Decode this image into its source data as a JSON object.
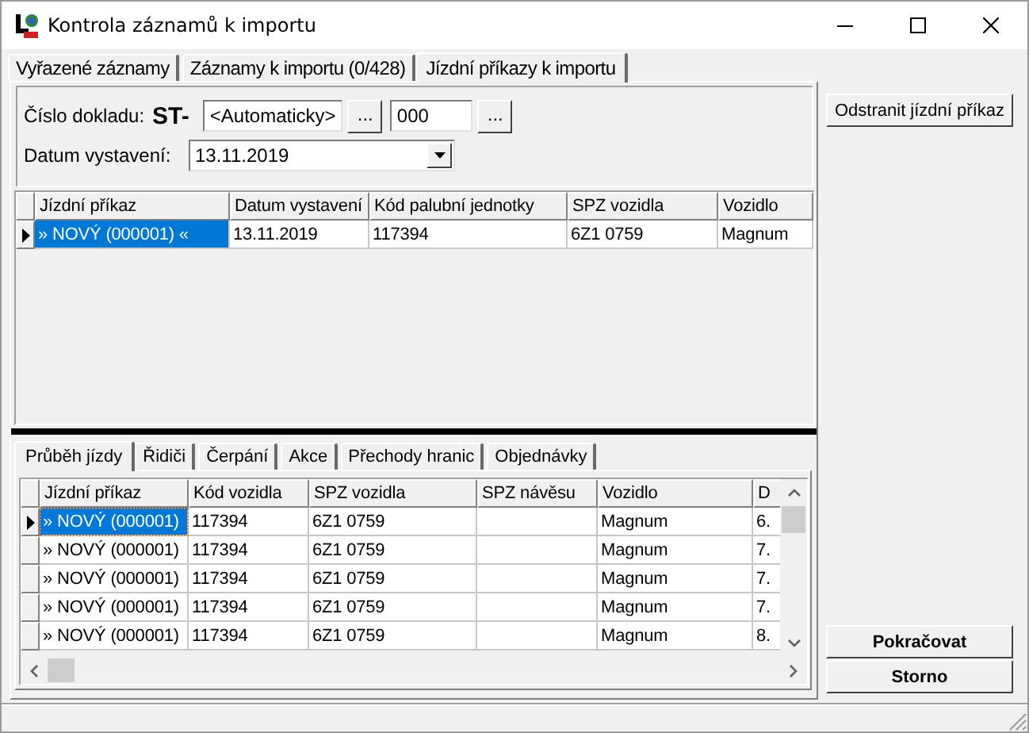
{
  "window": {
    "title": "Kontrola záznamů k importu"
  },
  "tabs": [
    {
      "label": "Vyřazené záznamy",
      "selected": false
    },
    {
      "label": "Záznamy k importu (0/428)",
      "selected": false
    },
    {
      "label": "Jízdní příkazy k importu",
      "selected": true
    }
  ],
  "document_form": {
    "number_label": "Číslo dokladu:",
    "prefix": "ST-",
    "number_value": "<Automaticky>",
    "number_button": "...",
    "sequence_value": "000",
    "sequence_button": "...",
    "date_label": "Datum vystavení:",
    "date_value": "13.11.2019"
  },
  "orders_table": {
    "columns": [
      "Jízdní příkaz",
      "Datum vystavení",
      "Kód palubní jednotky",
      "SPZ vozidla",
      "Vozidlo"
    ],
    "rows": [
      {
        "cells": [
          "» NOVÝ (000001) «",
          "13.11.2019",
          "117394",
          "6Z1 0759",
          "Magnum"
        ],
        "selected": true
      }
    ]
  },
  "detail_tabs": [
    {
      "label": "Průběh jízdy",
      "selected": true
    },
    {
      "label": "Řidiči",
      "selected": false
    },
    {
      "label": "Čerpání",
      "selected": false
    },
    {
      "label": "Akce",
      "selected": false
    },
    {
      "label": "Přechody hranic",
      "selected": false
    },
    {
      "label": "Objednávky",
      "selected": false
    }
  ],
  "detail_table": {
    "columns": [
      "Jízdní příkaz",
      "Kód vozidla",
      "SPZ vozidla",
      "SPZ návěsu",
      "Vozidlo",
      "D"
    ],
    "rows": [
      {
        "cells": [
          "» NOVÝ (000001)",
          "117394",
          "6Z1 0759",
          "",
          "Magnum",
          "6."
        ],
        "selected": true
      },
      {
        "cells": [
          "» NOVÝ (000001)",
          "117394",
          "6Z1 0759",
          "",
          "Magnum",
          "7."
        ],
        "selected": false
      },
      {
        "cells": [
          "» NOVÝ (000001)",
          "117394",
          "6Z1 0759",
          "",
          "Magnum",
          "7."
        ],
        "selected": false
      },
      {
        "cells": [
          "» NOVÝ (000001)",
          "117394",
          "6Z1 0759",
          "",
          "Magnum",
          "7."
        ],
        "selected": false
      },
      {
        "cells": [
          "» NOVÝ (000001)",
          "117394",
          "6Z1 0759",
          "",
          "Magnum",
          "8."
        ],
        "selected": false
      }
    ]
  },
  "remove_button": {
    "label": "Odstranit jízdní příkaz"
  },
  "footer_buttons": [
    {
      "label": "Pokračovat"
    },
    {
      "label": "Storno"
    }
  ]
}
